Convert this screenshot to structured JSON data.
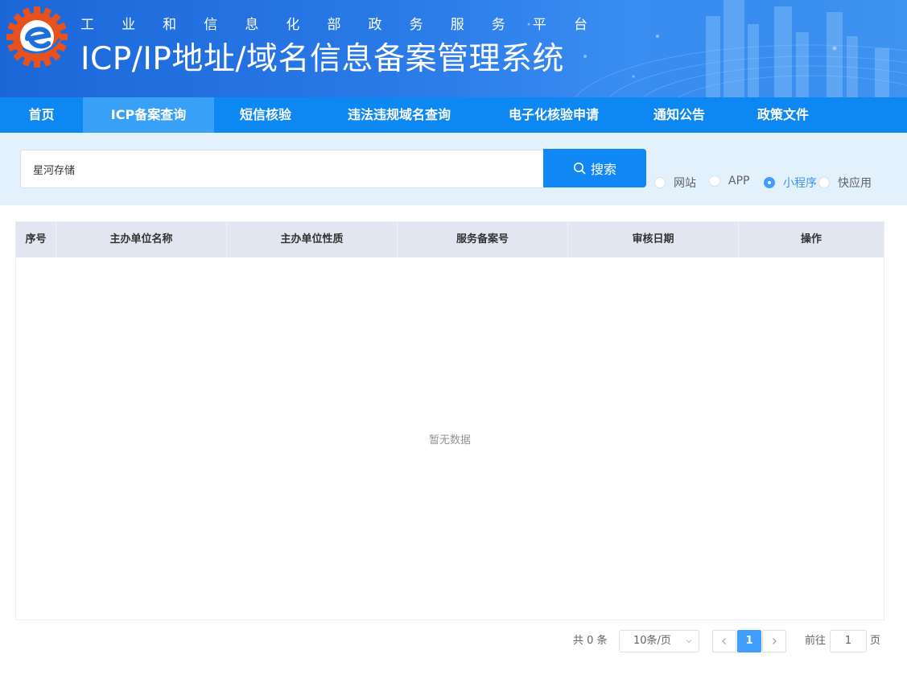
{
  "header": {
    "subtitle_chars": [
      "工",
      "业",
      "和",
      "信",
      "息",
      "化",
      "部",
      "政",
      "务",
      "服",
      "务",
      "平",
      "台"
    ],
    "title": "ICP/IP地址/域名信息备案管理系统",
    "logo_icon": "miit-gear-logo-icon"
  },
  "nav": {
    "items": [
      {
        "label": "首页"
      },
      {
        "label": "ICP备案查询",
        "active": true
      },
      {
        "label": "短信核验"
      },
      {
        "label": "违法违规域名查询"
      },
      {
        "label": "电子化核验申请"
      },
      {
        "label": "通知公告"
      },
      {
        "label": "政策文件"
      }
    ]
  },
  "search": {
    "value": "星河存储",
    "button_label": "搜索",
    "button_icon": "search-icon",
    "types": [
      {
        "label": "网站",
        "checked": false
      },
      {
        "label": "APP",
        "checked": false
      },
      {
        "label": "小程序",
        "checked": true
      },
      {
        "label": "快应用",
        "checked": false
      }
    ]
  },
  "table": {
    "columns": [
      "序号",
      "主办单位名称",
      "主办单位性质",
      "服务备案号",
      "审核日期",
      "操作"
    ],
    "rows": [],
    "empty_text": "暂无数据"
  },
  "pagination": {
    "total_text": "共 0 条",
    "page_size": "10条/页",
    "current_page": "1",
    "goto_label": "前往",
    "goto_value": "1",
    "goto_unit": "页"
  },
  "colors": {
    "nav_bg": "#0d87f2",
    "nav_active": "#39a0f7",
    "search_strip_bg": "#e3f1fc",
    "accent": "#409eff"
  }
}
